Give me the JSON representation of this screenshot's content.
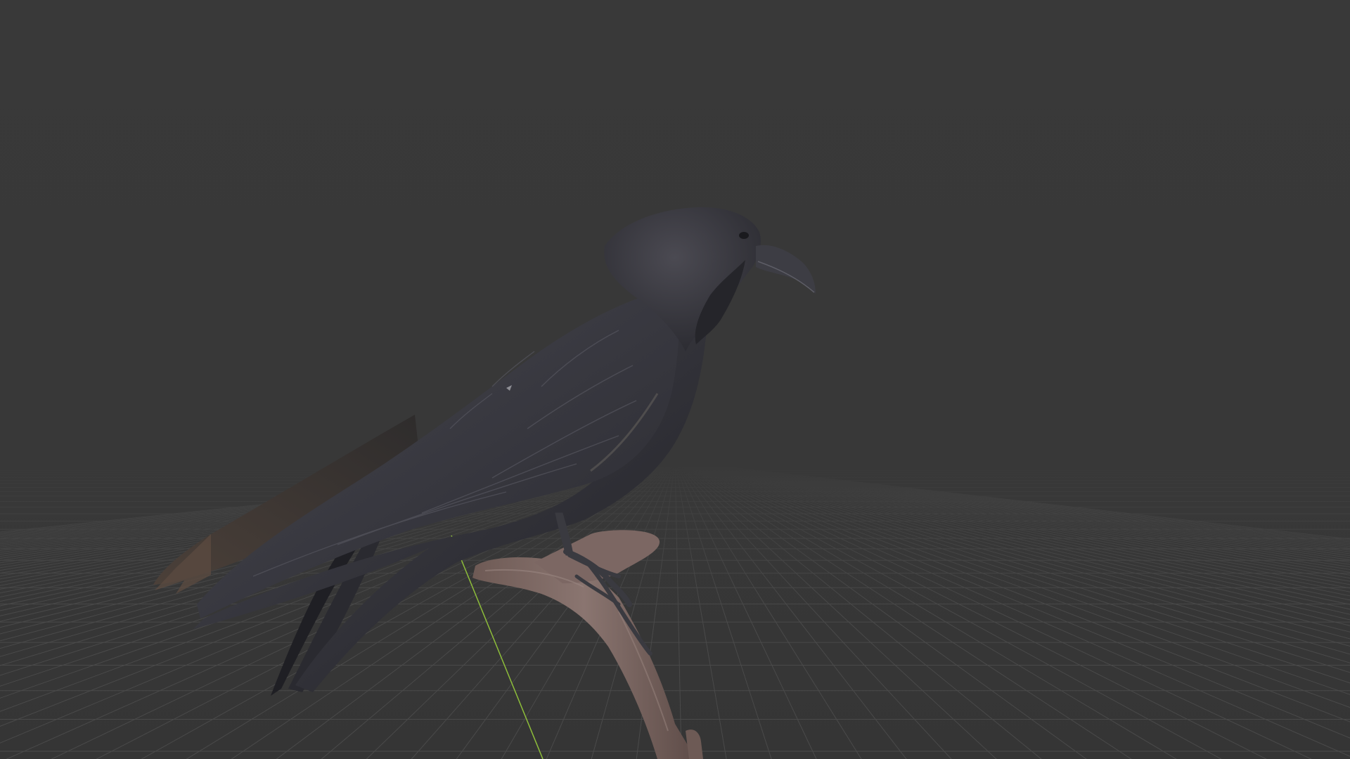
{
  "viewport": {
    "background_color": "#393939",
    "grid_color": "#4a4a4a",
    "y_axis_color": "#8dbd3a",
    "model_name": "raven-on-branch"
  },
  "scene": {
    "grid_visible": true,
    "y_axis_visible": true
  }
}
